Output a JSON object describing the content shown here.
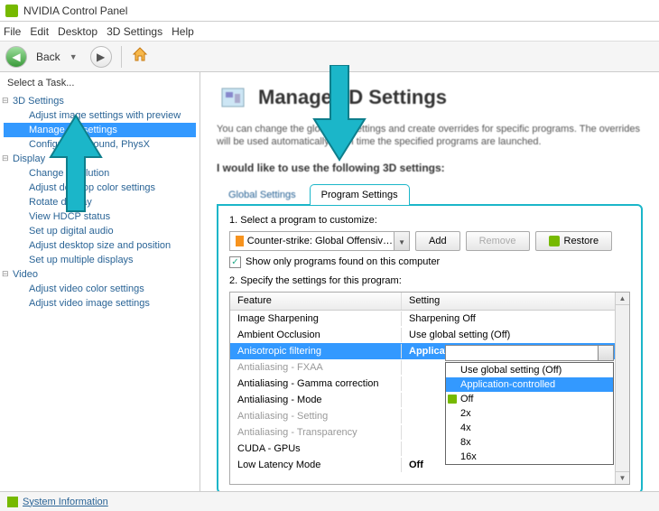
{
  "window": {
    "title": "NVIDIA Control Panel"
  },
  "menu": {
    "file": "File",
    "edit": "Edit",
    "desktop": "Desktop",
    "settings3d": "3D Settings",
    "help": "Help"
  },
  "toolbar": {
    "back_label": "Back"
  },
  "sidebar": {
    "task_label": "Select a Task...",
    "cats": [
      {
        "label": "3D Settings",
        "items": [
          "Adjust image settings with preview",
          "Manage 3D settings",
          "Configure Surround, PhysX"
        ]
      },
      {
        "label": "Display",
        "items": [
          "Change resolution",
          "Adjust desktop color settings",
          "Rotate display",
          "View HDCP status",
          "Set up digital audio",
          "Adjust desktop size and position",
          "Set up multiple displays"
        ]
      },
      {
        "label": "Video",
        "items": [
          "Adjust video color settings",
          "Adjust video image settings"
        ]
      }
    ]
  },
  "page": {
    "title": "Manage 3D Settings",
    "desc": "You can change the global 3D settings and create overrides for specific programs. The overrides will be used automatically each time the specified programs are launched.",
    "prompt": "I would like to use the following 3D settings:"
  },
  "tabs": {
    "global": "Global Settings",
    "program": "Program Settings"
  },
  "program_panel": {
    "step1": "1. Select a program to customize:",
    "selected_program": "Counter-strike: Global Offensiv…",
    "add": "Add",
    "remove": "Remove",
    "restore": "Restore",
    "show_only": "Show only programs found on this computer",
    "show_only_checked": true,
    "step2": "2. Specify the settings for this program:",
    "col_feature": "Feature",
    "col_setting": "Setting",
    "rows": [
      {
        "feature": "Image Sharpening",
        "setting": "Sharpening Off"
      },
      {
        "feature": "Ambient Occlusion",
        "setting": "Use global setting (Off)"
      },
      {
        "feature": "Anisotropic filtering",
        "setting": "Application-controlled",
        "selected": true,
        "bold": true
      },
      {
        "feature": "Antialiasing - FXAA",
        "setting": "",
        "dim": true
      },
      {
        "feature": "Antialiasing - Gamma correction",
        "setting": ""
      },
      {
        "feature": "Antialiasing - Mode",
        "setting": ""
      },
      {
        "feature": "Antialiasing - Setting",
        "setting": "",
        "dim": true
      },
      {
        "feature": "Antialiasing - Transparency",
        "setting": "",
        "dim": true
      },
      {
        "feature": "CUDA - GPUs",
        "setting": ""
      },
      {
        "feature": "Low Latency Mode",
        "setting": "Off",
        "bold": true
      }
    ],
    "dropdown": {
      "options": [
        "Use global setting (Off)",
        "Application-controlled",
        "Off",
        "2x",
        "4x",
        "8x",
        "16x"
      ],
      "highlighted_index": 1
    }
  },
  "statusbar": {
    "sysinfo": "System Information"
  }
}
